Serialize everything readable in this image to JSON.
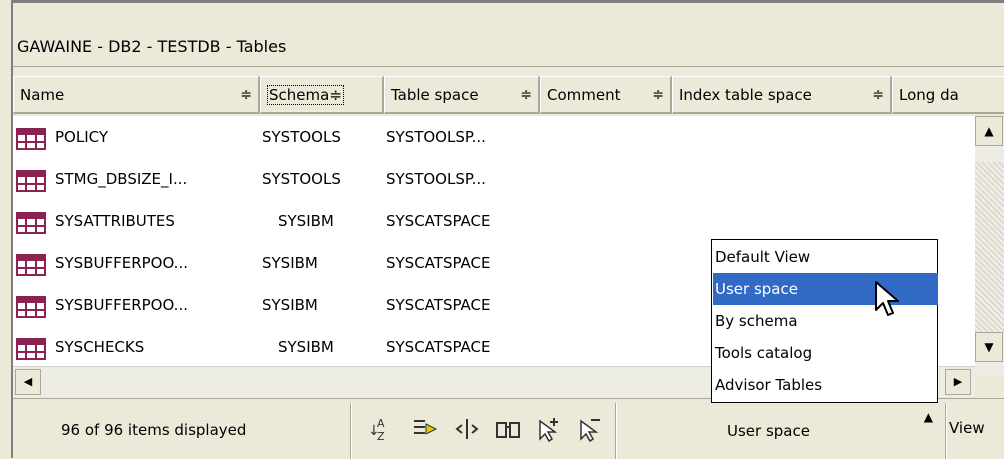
{
  "window": {
    "title": "GAWAINE - DB2 - TESTDB - Tables"
  },
  "columns": [
    {
      "label": "Name",
      "sort": "≑"
    },
    {
      "label": "Schema",
      "sort": "≑"
    },
    {
      "label": "Table space",
      "sort": "≑"
    },
    {
      "label": "Comment",
      "sort": "≑"
    },
    {
      "label": "Index table space",
      "sort": "≑"
    },
    {
      "label": "Long da"
    }
  ],
  "rows": [
    {
      "name": "POLICY",
      "schema": "SYSTOOLS",
      "tablespace": "SYSTOOLSP..."
    },
    {
      "name": "STMG_DBSIZE_I...",
      "schema": "SYSTOOLS",
      "tablespace": "SYSTOOLSP..."
    },
    {
      "name": "SYSATTRIBUTES",
      "schema": "SYSIBM",
      "tablespace": "SYSCATSPACE"
    },
    {
      "name": "SYSBUFFERPOO...",
      "schema": "SYSIBM",
      "tablespace": "SYSCATSPACE"
    },
    {
      "name": "SYSBUFFERPOO...",
      "schema": "SYSIBM",
      "tablespace": "SYSCATSPACE"
    },
    {
      "name": "SYSCHECKS",
      "schema": "SYSIBM",
      "tablespace": "SYSCATSPACE"
    }
  ],
  "status": {
    "items_count": "96 of 96 items displayed",
    "view_selected": "User space",
    "view_button": "View"
  },
  "toolbar_icons": [
    "sort-az-icon",
    "filter-icon",
    "column-width-icon",
    "find-icon",
    "select-all-icon",
    "deselect-icon"
  ],
  "view_menu": {
    "options": [
      "Default View",
      "User space",
      "By schema",
      "Tools catalog",
      "Advisor Tables"
    ],
    "selected_index": 1
  },
  "colors": {
    "selection": "#316AC5",
    "chrome": "#ECE9D8",
    "table_icon": "#8b2252"
  }
}
